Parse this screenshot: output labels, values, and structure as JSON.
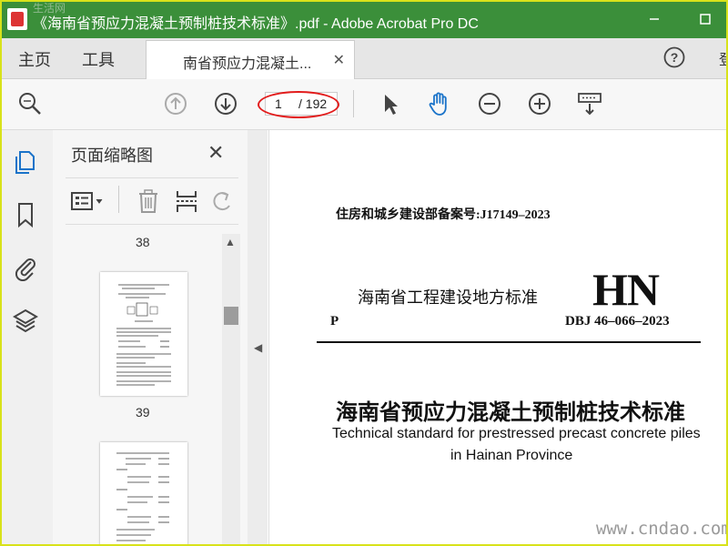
{
  "window": {
    "title": "《海南省预应力混凝土预制桩技术标准》.pdf - Adobe Acrobat Pro DC",
    "watermark_top": "生活网"
  },
  "tabs": {
    "home": "主页",
    "tools": "工具",
    "document": "南省预应力混凝土...",
    "edge_text": "登"
  },
  "toolbar": {
    "current_page": "1",
    "total_pages": "/ 192"
  },
  "thumbnail_panel": {
    "title": "页面缩略图",
    "page_labels": [
      "38",
      "39"
    ]
  },
  "document": {
    "record_no": "住房和城乡建设部备案号:J17149–2023",
    "region_title": "海南省工程建设地方标准",
    "hn_mark": "HN",
    "p_mark": "P",
    "std_no": "DBJ 46–066–2023",
    "title_cn": "海南省预应力混凝土预制桩技术标准",
    "title_en_1": "Technical standard for prestressed precast concrete piles",
    "title_en_2": "in Hainan Province"
  },
  "watermark": "www.cndao.com",
  "colors": {
    "titlebar": "#3b8f3a",
    "frame": "#d8e21a",
    "annotation": "#e21b1b",
    "hand_tool": "#1a73c9"
  }
}
